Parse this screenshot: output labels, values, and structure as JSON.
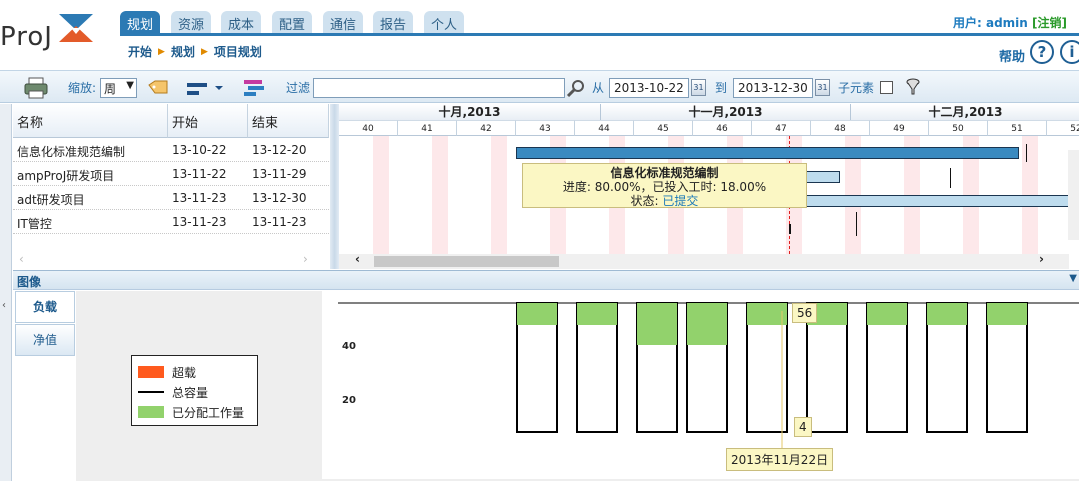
{
  "app": {
    "logo_text": "ProJ"
  },
  "nav": {
    "tabs": [
      "规划",
      "资源",
      "成本",
      "配置",
      "通信",
      "报告",
      "个人"
    ],
    "active": 0
  },
  "breadcrumb": [
    "开始",
    "规划",
    "项目规划"
  ],
  "user": {
    "prefix": "用户:",
    "name": "admin",
    "logout": "[注销]"
  },
  "help": {
    "label": "帮助",
    "help_icon": "?",
    "info_icon": "i"
  },
  "toolbar": {
    "zoom_label": "缩放:",
    "zoom_value": "周",
    "filter_label": "过滤",
    "filter_value": "",
    "from_label": "从",
    "from_date": "2013-10-22",
    "to_label": "到",
    "to_date": "2013-12-30",
    "child_label": "子元素"
  },
  "grid": {
    "headers": [
      "名称",
      "开始",
      "结束"
    ],
    "rows": [
      {
        "name": "信息化标准规范编制",
        "start": "13-10-22",
        "end": "13-12-20"
      },
      {
        "name": "ampProJ研发项目",
        "start": "13-11-22",
        "end": "13-11-29"
      },
      {
        "name": "adt研发项目",
        "start": "13-11-23",
        "end": "13-12-30"
      },
      {
        "name": "IT管控",
        "start": "13-11-23",
        "end": "13-11-23"
      }
    ]
  },
  "gantt": {
    "months": [
      "十月,2013",
      "十一月,2013",
      "十二月,2013"
    ],
    "weeks": [
      "40",
      "41",
      "42",
      "43",
      "44",
      "45",
      "46",
      "47",
      "48",
      "49",
      "50",
      "51",
      "52"
    ]
  },
  "tooltip": {
    "title": "信息化标准规范编制",
    "progress": "进度: 80.00%，已投入工时: 18.00%",
    "status_label": "状态:",
    "status_value": "已提交"
  },
  "panel": {
    "title": "图像",
    "tabs": [
      "负载",
      "净值"
    ]
  },
  "chart": {
    "ticks": [
      "40",
      "20"
    ],
    "legend": [
      "超载",
      "总容量",
      "已分配工作量"
    ],
    "colors": {
      "overload": "#ff5a1e",
      "capacity": "#000000",
      "allocated": "#92d26c"
    },
    "callout_top": "56",
    "callout_bottom": "4",
    "date_label": "2013年11月22日"
  },
  "chart_data": {
    "type": "area",
    "title": "",
    "xlabel": "",
    "ylabel": "",
    "series": [
      {
        "name": "超载",
        "values": []
      },
      {
        "name": "总容量",
        "values": [
          0,
          56,
          0,
          56,
          0,
          56,
          0,
          56,
          0,
          56,
          0,
          56,
          0,
          56,
          0,
          56,
          0,
          56,
          0,
          56,
          0,
          56
        ]
      },
      {
        "name": "已分配工作量",
        "values": [
          0,
          4,
          0,
          4,
          0,
          4,
          0,
          4,
          0,
          4,
          0,
          4,
          0,
          4,
          0,
          4,
          0,
          4,
          0,
          4,
          0,
          4
        ]
      }
    ],
    "ylim": [
      0,
      56
    ]
  }
}
